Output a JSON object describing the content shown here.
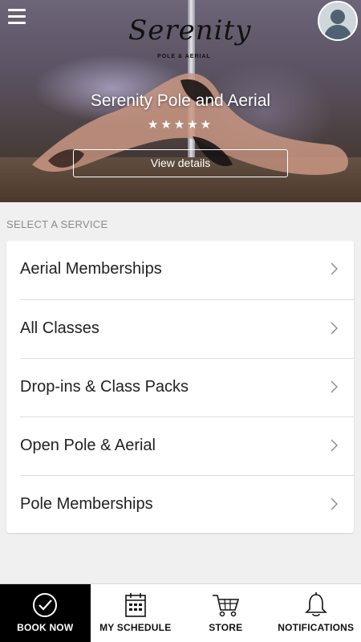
{
  "header": {
    "menu_icon": "hamburger-menu-icon",
    "avatar_icon": "user-avatar-icon",
    "logo_text": "Serenity",
    "logo_subtext": "POLE & AERIAL"
  },
  "studio": {
    "name": "Serenity Pole and Aerial",
    "rating_stars": "★★★★★",
    "view_details_label": "View details"
  },
  "services": {
    "section_label": "SELECT A SERVICE",
    "items": [
      {
        "label": "Aerial Memberships"
      },
      {
        "label": "All Classes"
      },
      {
        "label": "Drop-ins & Class Packs"
      },
      {
        "label": "Open Pole & Aerial"
      },
      {
        "label": "Pole Memberships"
      }
    ]
  },
  "bottom_nav": {
    "tabs": [
      {
        "label": "BOOK NOW",
        "icon": "check-circle-icon",
        "active": true
      },
      {
        "label": "MY SCHEDULE",
        "icon": "calendar-icon",
        "active": false
      },
      {
        "label": "STORE",
        "icon": "shopping-cart-icon",
        "active": false
      },
      {
        "label": "NOTIFICATIONS",
        "icon": "bell-icon",
        "active": false
      }
    ]
  },
  "colors": {
    "active_tab_bg": "#000000",
    "card_bg": "#ffffff",
    "page_bg": "#f0f0f0"
  }
}
